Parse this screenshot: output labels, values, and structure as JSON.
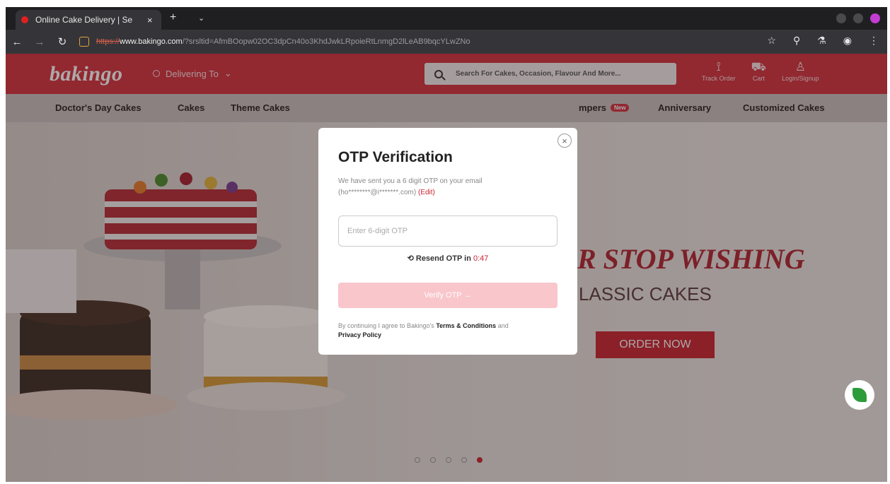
{
  "browser": {
    "tab_title": "Online Cake Delivery | Se",
    "tab_close": "×",
    "new_tab": "+",
    "tab_list": "⌄",
    "url_scheme": "https://",
    "url_host": "www.bakingo.com",
    "url_rest": "/?srsltid=AfmBOopw02OC3dpCn40o3KhdJwkLRpoieRtLnmgD2lLeAB9bqcYLwZNo"
  },
  "header": {
    "logo": "bakingo",
    "delivering_to": "Delivering To",
    "search_placeholder": "Search For Cakes, Occasion, Flavour And More...",
    "track_order": "Track Order",
    "cart": "Cart",
    "login": "Login/Signup"
  },
  "nav": {
    "items": [
      "Doctor's Day Cakes",
      "Cakes",
      "Theme Cakes",
      "mpers",
      "Anniversary",
      "Customized Cakes"
    ],
    "new_badge": "New"
  },
  "banner": {
    "headline": "R STOP WISHING",
    "subheadline": "LASSIC CAKES",
    "cta": "ORDER NOW"
  },
  "modal": {
    "title": "OTP Verification",
    "desc_line": "We have sent you a 6 digit OTP on your email",
    "email": "(ho********@i*******.com)",
    "edit": "(Edit)",
    "otp_placeholder": "Enter 6-digit OTP",
    "resend_label": "Resend OTP in",
    "timer": "0:47",
    "verify_label": "Verify OTP  →",
    "terms_prefix": "By continuing I agree to Bakingo's",
    "terms_link": "Terms & Conditions",
    "terms_and": "and",
    "privacy_link": "Privacy Policy",
    "close": "×"
  },
  "carousel": {
    "slides": 5,
    "active": 5
  },
  "colors": {
    "brand_red": "#d32f3d",
    "accent_red": "#c8222f",
    "verify_disabled": "#f8c6cb"
  }
}
